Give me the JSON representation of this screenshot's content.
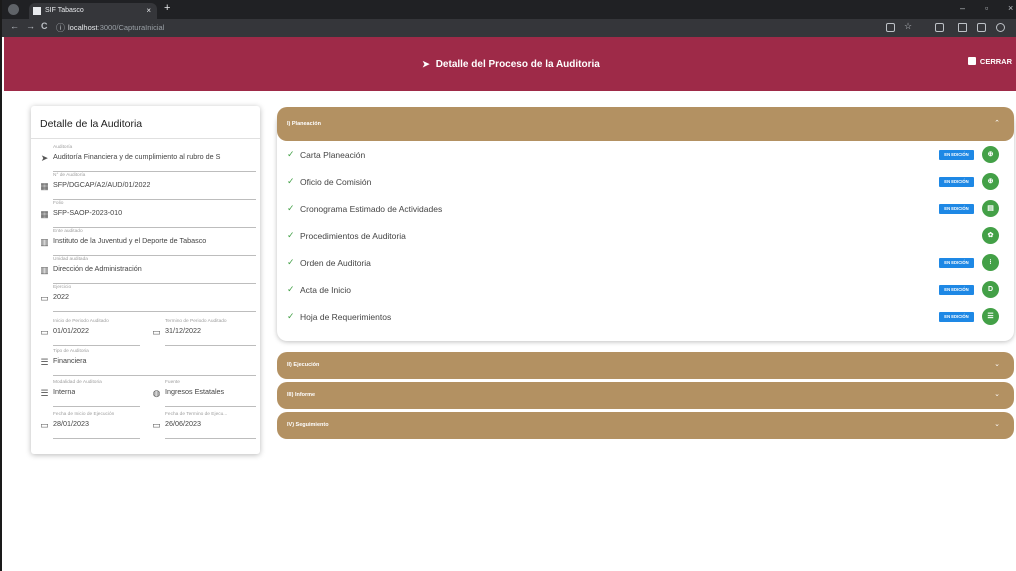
{
  "browser": {
    "tab_title": "SIF Tabasco",
    "tab_close": "×",
    "new_tab": "+",
    "url_host": "localhost",
    "url_path": ":3000/CapturaInicial",
    "nav": {
      "back": "←",
      "forward": "→",
      "reload": "C",
      "info": "ⓘ"
    },
    "window": {
      "minimize": "–",
      "maximize": "▫",
      "close": "×"
    }
  },
  "header": {
    "title": "Detalle del Proceso de la Auditoria",
    "close_label": "CERRAR",
    "color": "#9e2a48"
  },
  "detail_card": {
    "title": "Detalle de la Auditoria",
    "fields": [
      {
        "label": "Auditoría",
        "value": "Auditoría Financiera y de cumplimiento al rubro de S",
        "icon": "chevron-right-icon"
      },
      {
        "label": "N° de Auditoría",
        "value": "SFP/DGCAP/A2/AUD/01/2022",
        "icon": "table-icon"
      },
      {
        "label": "Folio",
        "value": "SFP-SAOP-2023-010",
        "icon": "table-icon"
      },
      {
        "label": "Ente auditado",
        "value": "Instituto de la Juventud y el Deporte de Tabasco",
        "icon": "building-icon"
      },
      {
        "label": "Unidad auditada",
        "value": "Dirección de Administración",
        "icon": "building-icon"
      },
      {
        "label": "Ejercicio",
        "value": "2022",
        "icon": "calendar-icon"
      },
      {
        "label": "Inicio de Periodo Auditado",
        "value": "01/01/2022",
        "icon": "calendar-icon"
      },
      {
        "label": "Termino de Periodo Auditado",
        "value": "31/12/2022",
        "icon": "calendar-icon"
      },
      {
        "label": "Tipo de Auditoria",
        "value": "Financiera",
        "icon": "list-icon"
      },
      {
        "label": "Modalidad de Auditoria",
        "value": "Interna",
        "icon": "list-icon"
      },
      {
        "label": "Fuente",
        "value": "Ingresos Estatales",
        "icon": "globe-icon"
      },
      {
        "label": "Fecha de Inicio de Ejecución",
        "value": "28/01/2023",
        "icon": "calendar-icon"
      },
      {
        "label": "Fecha de Termino de Ejecu...",
        "value": "26/06/2023",
        "icon": "calendar-icon"
      }
    ]
  },
  "sections": [
    {
      "label": "I) Planeación",
      "expanded": true,
      "caret": "⌃"
    },
    {
      "label": "II) Ejecución",
      "expanded": false,
      "caret": "⌄"
    },
    {
      "label": "III) Informe",
      "expanded": false,
      "caret": "⌄"
    },
    {
      "label": "IV) Seguimiento",
      "expanded": false,
      "caret": "⌄"
    }
  ],
  "planning_items": [
    {
      "name": "Carta Planeación",
      "status": "EN EDICIÓN",
      "action_icon": "stamp-icon",
      "action_glyph": "⊕"
    },
    {
      "name": "Oficio de Comisión",
      "status": "EN EDICIÓN",
      "action_icon": "stamp-icon",
      "action_glyph": "⊕"
    },
    {
      "name": "Cronograma Estimado de Actividades",
      "status": "EN EDICIÓN",
      "action_icon": "chart-icon",
      "action_glyph": "▤"
    },
    {
      "name": "Procedimientos de Auditoria",
      "status": "",
      "action_icon": "gear-icon",
      "action_glyph": "✿"
    },
    {
      "name": "Orden de Auditoria",
      "status": "EN EDICIÓN",
      "action_icon": "grid-icon",
      "action_glyph": "⁝"
    },
    {
      "name": "Acta de Inicio",
      "status": "EN EDICIÓN",
      "action_icon": "document-icon",
      "action_glyph": "D"
    },
    {
      "name": "Hoja de Requerimientos",
      "status": "EN EDICIÓN",
      "action_icon": "list-icon",
      "action_glyph": "☰"
    }
  ],
  "colors": {
    "section_header": "#b39162",
    "badge": "#1e88e5",
    "action": "#43a047",
    "check": "#43a047"
  }
}
